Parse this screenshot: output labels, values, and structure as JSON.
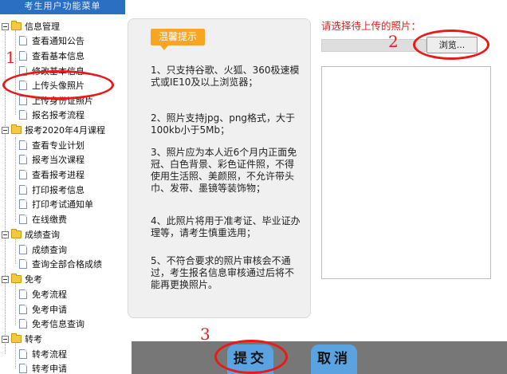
{
  "sidebar": {
    "title": "考生用户功能菜单",
    "sections": [
      {
        "label": "信息管理",
        "items": [
          "查看通知公告",
          "查看基本信息",
          "修改基本信息",
          "上传头像照片",
          "上传身份证照片",
          "报名报考流程"
        ]
      },
      {
        "label": "报考2020年4月课程",
        "items": [
          "查看专业计划",
          "报考当次课程",
          "查看报考进程",
          "打印报考信息",
          "打印考试通知单",
          "在线缴费"
        ]
      },
      {
        "label": "成绩查询",
        "items": [
          "成绩查询",
          "查询全部合格成绩"
        ]
      },
      {
        "label": "免考",
        "items": [
          "免考流程",
          "免考申请",
          "免考信息查询"
        ]
      },
      {
        "label": "转考",
        "items": [
          "转考流程",
          "转考申请"
        ]
      }
    ]
  },
  "tips": {
    "badge": "温馨提示",
    "items": [
      "1、只支持谷歌、火狐、360极速模式或IE10及以上浏览器；",
      "2、照片支持jpg、png格式，大于100kb小于5Mb；",
      "3、照片应为本人近6个月内正面免冠、白色背景、彩色证件照，不得使用生活照、美颜照，不允许带头巾、发带、墨镜等装饰物；",
      "4、此照片将用于准考证、毕业证办理等，请考生慎重选用；",
      "5、不符合要求的照片审核会不通过，考生报名信息审核通过后将不能再更换照片。"
    ]
  },
  "upload": {
    "label": "请选择待上传的照片：",
    "browse_label": "浏览..."
  },
  "actions": {
    "submit_label": "提交",
    "cancel_label": "取消"
  },
  "annotations": {
    "step1": "1",
    "step2": "2",
    "step3": "3",
    "color": "#e81a1a"
  }
}
